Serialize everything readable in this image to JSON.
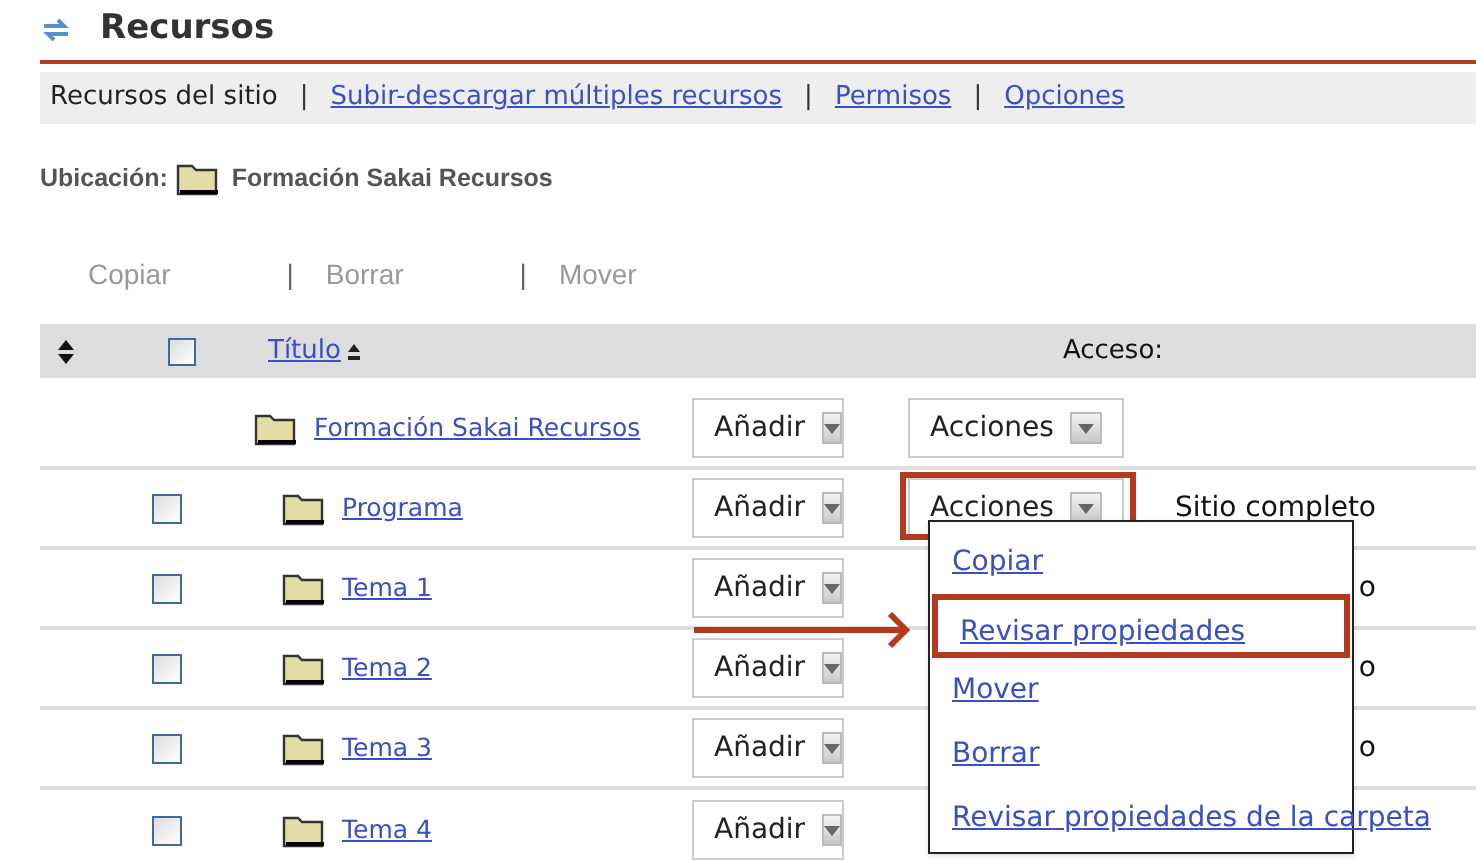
{
  "title": "Recursos",
  "nav": [
    {
      "label": "Recursos del sitio",
      "kind": "text"
    },
    {
      "label": "|",
      "kind": "separator"
    },
    {
      "label": "Subir-descargar múltiples recursos",
      "kind": "link"
    },
    {
      "label": "|",
      "kind": "separator"
    },
    {
      "label": "Permisos",
      "kind": "link"
    },
    {
      "label": "|",
      "kind": "separator"
    },
    {
      "label": "Opciones",
      "kind": "link"
    }
  ],
  "location": {
    "label": "Ubicación:",
    "folder": "Formación Sakai Recursos"
  },
  "toolbar": [
    {
      "label": "Copiar",
      "kind": "button"
    },
    {
      "label": "|",
      "kind": "separator"
    },
    {
      "label": "Borrar",
      "kind": "button"
    },
    {
      "label": "|",
      "kind": "separator"
    },
    {
      "label": "Mover",
      "kind": "button"
    }
  ],
  "table": {
    "columns": [
      "Título",
      "Acceso:"
    ],
    "select_all_checked": false,
    "rows": [
      {
        "kind": "parent",
        "title": "Formación Sakai Recursos",
        "add": "Añadir",
        "actions": "Acciones",
        "highlighted": false
      },
      {
        "kind": "child",
        "title": "Programa",
        "checked": false,
        "add": "Añadir",
        "actions": "Acciones",
        "highlighted": true,
        "access": "Sitio completo"
      },
      {
        "kind": "child",
        "title": "Tema 1",
        "checked": false,
        "add": "Añadir",
        "highlighted": false,
        "access": "o"
      },
      {
        "kind": "child",
        "title": "Tema 2",
        "checked": false,
        "add": "Añadir",
        "highlighted": false,
        "access": "o"
      },
      {
        "kind": "child",
        "title": "Tema 3",
        "checked": false,
        "add": "Añadir",
        "highlighted": false,
        "access": "o"
      },
      {
        "kind": "child",
        "title": "Tema 4",
        "checked": false,
        "add": "Añadir",
        "highlighted": false
      }
    ]
  },
  "menu": [
    {
      "label": "Copiar",
      "selected": false
    },
    {
      "label": "Revisar propiedades",
      "selected": true
    },
    {
      "label": "Mover",
      "selected": false
    },
    {
      "label": "Borrar",
      "selected": false
    },
    {
      "label": "Revisar propiedades de la carpeta",
      "selected": false
    }
  ]
}
